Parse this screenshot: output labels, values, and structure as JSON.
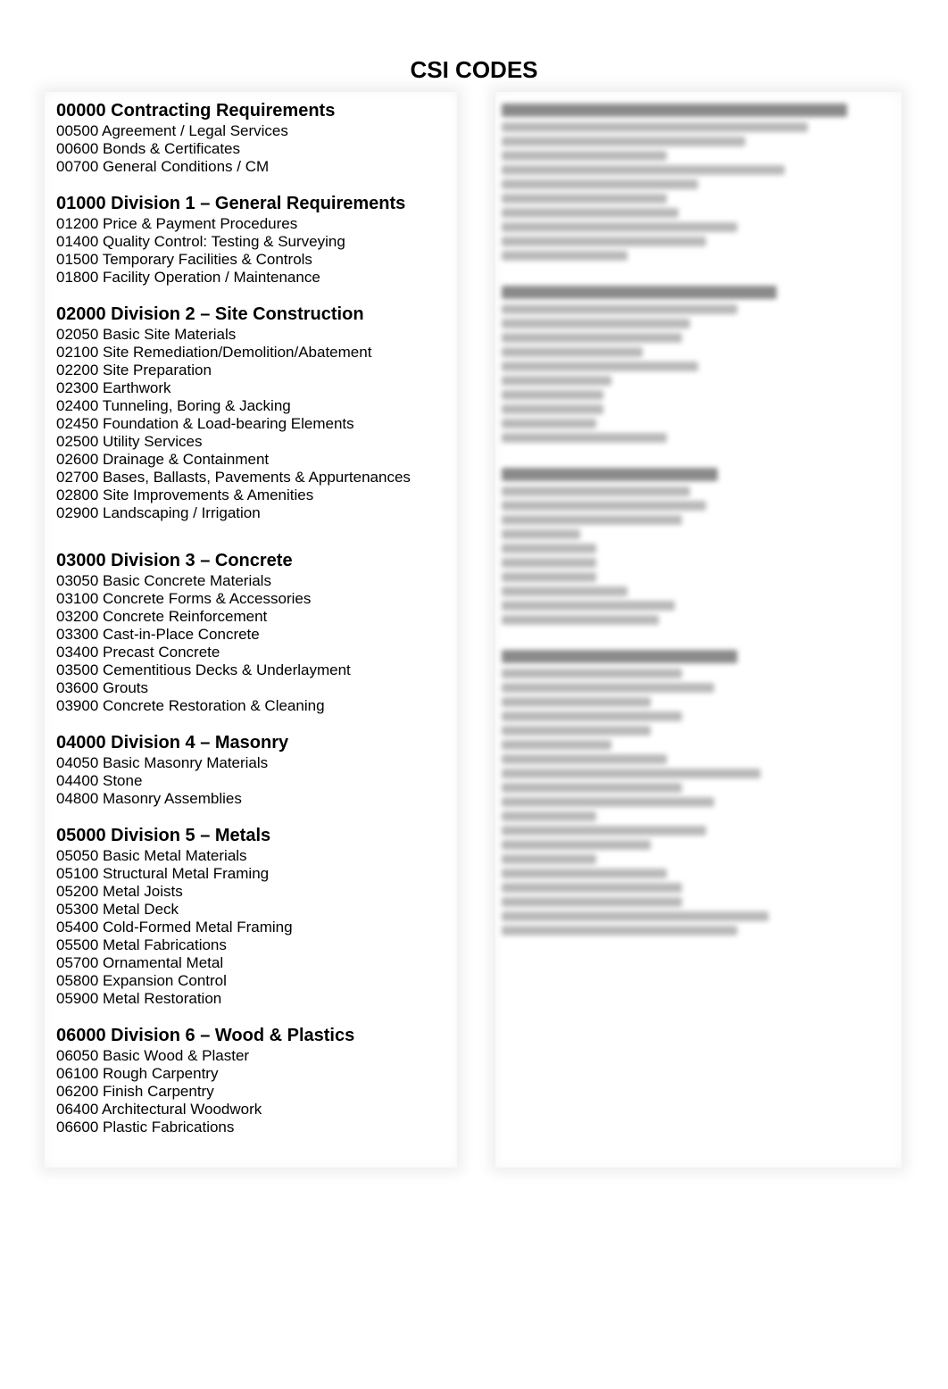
{
  "title": "CSI CODES",
  "sections": [
    {
      "heading": "00000 Contracting Requirements",
      "items": [
        "00500 Agreement / Legal Services",
        "00600 Bonds & Certificates",
        "00700 General Conditions / CM"
      ]
    },
    {
      "heading": "01000 Division 1 – General Requirements",
      "items": [
        "01200 Price & Payment Procedures",
        "01400 Quality Control:  Testing & Surveying",
        "01500 Temporary Facilities & Controls",
        "01800 Facility Operation / Maintenance"
      ]
    },
    {
      "heading": "02000 Division 2 – Site Construction",
      "items": [
        "02050 Basic Site Materials",
        "02100 Site Remediation/Demolition/Abatement",
        "02200 Site Preparation",
        "02300 Earthwork",
        "02400 Tunneling, Boring & Jacking",
        "02450 Foundation & Load-bearing Elements",
        "02500 Utility Services",
        "02600 Drainage & Containment",
        "02700 Bases, Ballasts, Pavements & Appurtenances",
        "02800 Site Improvements & Amenities",
        "02900 Landscaping / Irrigation"
      ]
    },
    {
      "heading": "03000 Division 3 – Concrete",
      "items": [
        "03050 Basic Concrete Materials",
        "03100 Concrete Forms & Accessories",
        "03200 Concrete Reinforcement",
        "03300 Cast-in-Place Concrete",
        "03400 Precast Concrete",
        "03500 Cementitious Decks & Underlayment",
        "03600 Grouts",
        "03900 Concrete Restoration & Cleaning"
      ]
    },
    {
      "heading": "04000 Division 4 – Masonry",
      "items": [
        "04050 Basic Masonry Materials",
        "04400 Stone",
        "04800 Masonry Assemblies"
      ]
    },
    {
      "heading": "05000 Division 5 – Metals",
      "items": [
        "05050 Basic Metal Materials",
        "05100 Structural Metal Framing",
        "05200 Metal Joists",
        "05300 Metal Deck",
        "05400 Cold-Formed Metal Framing",
        "05500 Metal Fabrications",
        "05700 Ornamental Metal",
        "05800 Expansion Control",
        "05900 Metal Restoration"
      ]
    },
    {
      "heading": "06000 Division 6 – Wood & Plastics",
      "items": [
        "06050 Basic Wood & Plaster",
        "06100 Rough Carpentry",
        "06200 Finish Carpentry",
        "06400 Architectural Woodwork",
        "06600 Plastic Fabrications"
      ]
    }
  ],
  "blurred_column": {
    "sections": [
      {
        "heading_len": 0.88,
        "lines": [
          0.78,
          0.62,
          0.42,
          0.72,
          0.5,
          0.42,
          0.45,
          0.6,
          0.52,
          0.32
        ]
      },
      {
        "heading_len": 0.7,
        "lines": [
          0.6,
          0.48,
          0.46,
          0.36,
          0.5,
          0.28,
          0.26,
          0.26,
          0.24,
          0.42
        ]
      },
      {
        "heading_len": 0.55,
        "lines": [
          0.48,
          0.52,
          0.46,
          0.2,
          0.24,
          0.24,
          0.24,
          0.32,
          0.44,
          0.4
        ]
      },
      {
        "heading_len": 0.6,
        "lines": [
          0.46,
          0.54,
          0.38,
          0.46,
          0.38,
          0.28,
          0.42,
          0.66,
          0.46,
          0.54,
          0.24,
          0.52,
          0.38,
          0.24,
          0.42,
          0.46,
          0.46,
          0.68,
          0.6
        ]
      }
    ]
  }
}
